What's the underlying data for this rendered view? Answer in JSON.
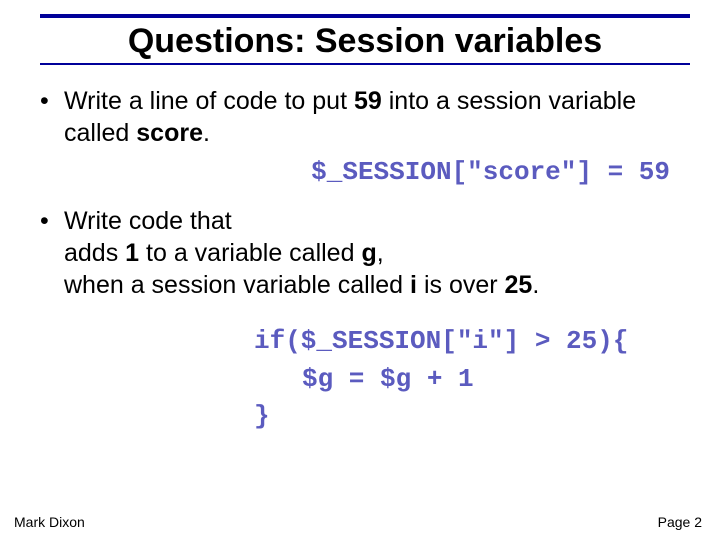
{
  "title": "Questions: Session variables",
  "bullet1": {
    "pre": "Write a line of code to put ",
    "num": "59",
    "mid": " into a session variable called ",
    "var": "score",
    "post": "."
  },
  "answer1": "$_SESSION[\"score\"] = 59",
  "bullet2": {
    "l1": "Write code that",
    "l2a": "adds ",
    "l2b": "1",
    "l2c": " to a variable called ",
    "l2d": "g",
    "l2e": ",",
    "l3a": "when a session variable called ",
    "l3b": "i",
    "l3c": " is over ",
    "l3d": "25",
    "l3e": "."
  },
  "answer2": {
    "l1": "if($_SESSION[\"i\"] > 25){",
    "l2": "$g = $g + 1",
    "l3": "}"
  },
  "footer": {
    "left": "Mark Dixon",
    "right": "Page 2"
  }
}
